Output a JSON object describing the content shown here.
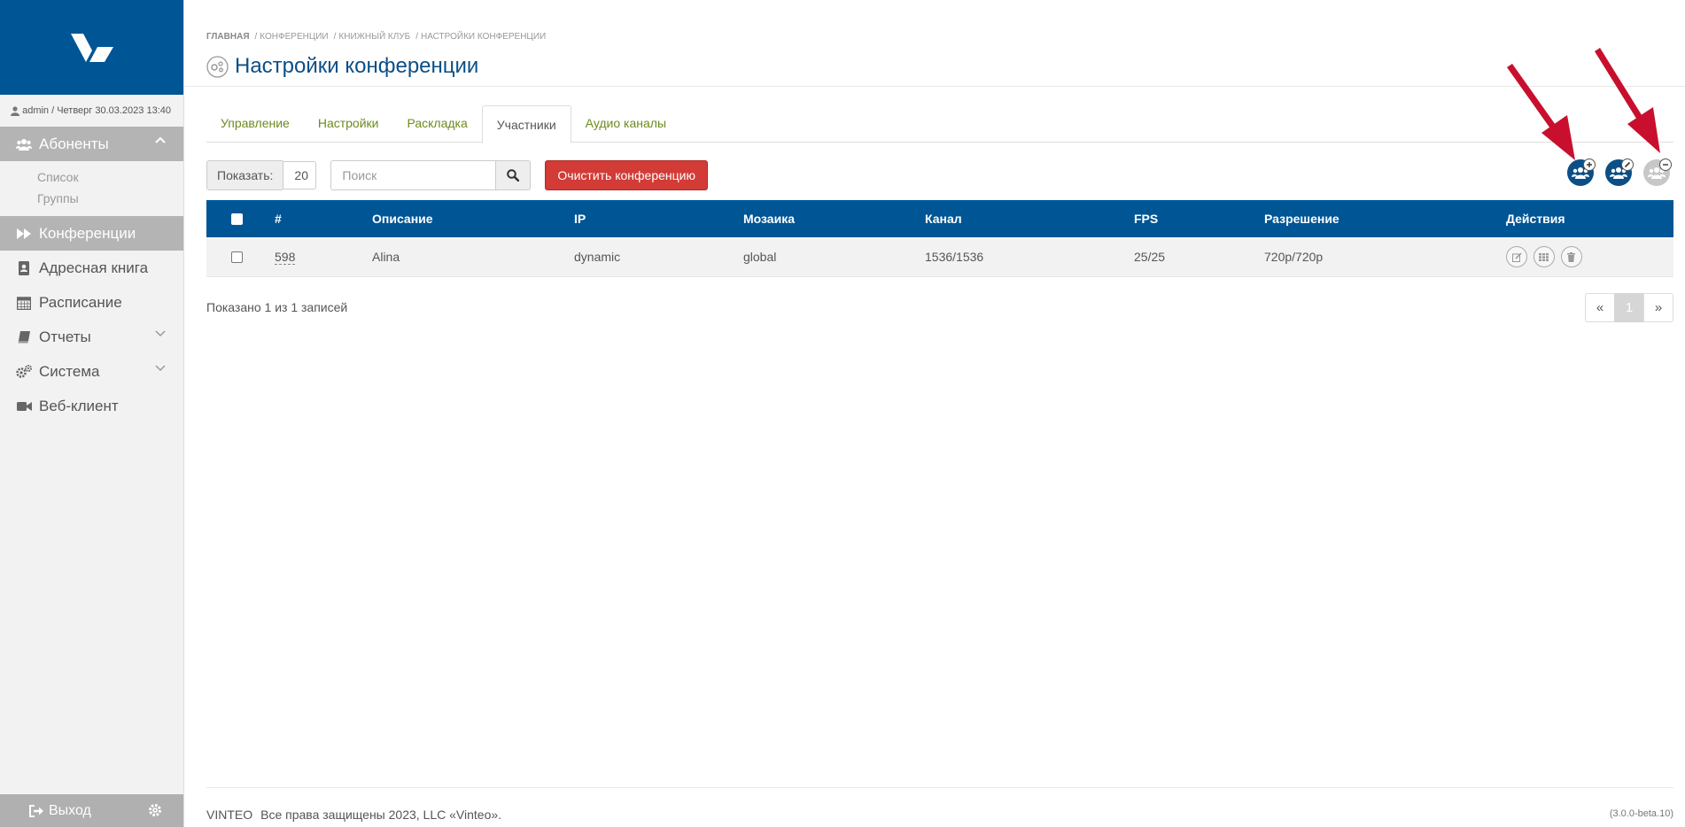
{
  "sidebar": {
    "user": "admin / Четверг 30.03.2023 13:40",
    "nav": {
      "subscribers": "Абоненты",
      "list": "Список",
      "groups": "Группы",
      "conferences": "Конференции",
      "addressbook": "Адресная книга",
      "schedule": "Расписание",
      "reports": "Отчеты",
      "system": "Система",
      "webclient": "Веб-клиент"
    },
    "logout": "Выход"
  },
  "breadcrumb": {
    "home": "ГЛАВНАЯ",
    "items": [
      "КОНФЕРЕНЦИИ",
      "КНИЖНЫЙ КЛУБ",
      "НАСТРОЙКИ КОНФЕРЕНЦИИ"
    ]
  },
  "page": {
    "title": "Настройки конференции"
  },
  "tabs": [
    "Управление",
    "Настройки",
    "Раскладка",
    "Участники",
    "Аудио каналы"
  ],
  "active_tab": "Участники",
  "toolbar": {
    "show_label": "Показать:",
    "show_value": "20",
    "search_placeholder": "Поиск",
    "clear_label": "Очистить конференцию"
  },
  "table": {
    "columns": [
      "#",
      "Описание",
      "IP",
      "Мозаика",
      "Канал",
      "FPS",
      "Разрешение",
      "Действия"
    ],
    "rows": [
      {
        "id": "598",
        "description": "Alina",
        "ip": "dynamic",
        "mosaic": "global",
        "channel": "1536/1536",
        "fps": "25/25",
        "resolution": "720p/720p"
      }
    ]
  },
  "records_info": "Показано 1 из 1 записей",
  "pagination": {
    "prev": "«",
    "current": "1",
    "next": "»"
  },
  "footer": {
    "brand": "VINTEO",
    "copyright": "Все права защищены 2023, LLC «Vinteo».",
    "version": "(3.0.0-beta.10)"
  },
  "colors": {
    "brand_blue": "#005595",
    "title_blue": "#0b4f86",
    "tab_link_green": "#6c8b20",
    "danger_red": "#d23b36",
    "annotation_arrow": "#c8102e",
    "sidebar_active": "#b4b4b4"
  },
  "icons": {
    "logo": "vinteo-logo",
    "user": "user-icon",
    "subscribers": "users-icon",
    "conferences": "fast-forward-icon",
    "addressbook": "address-book-icon",
    "schedule": "calendar-icon",
    "reports": "book-icon",
    "system": "gears-icon",
    "webclient": "video-camera-icon",
    "logout": "sign-out-icon",
    "settings": "gear-icon",
    "add_participant": "users-plus-icon",
    "edit_participants": "users-edit-icon",
    "remove_participant": "users-minus-icon",
    "row_edit": "edit-icon",
    "row_layout": "grid-icon",
    "row_delete": "trash-icon"
  }
}
